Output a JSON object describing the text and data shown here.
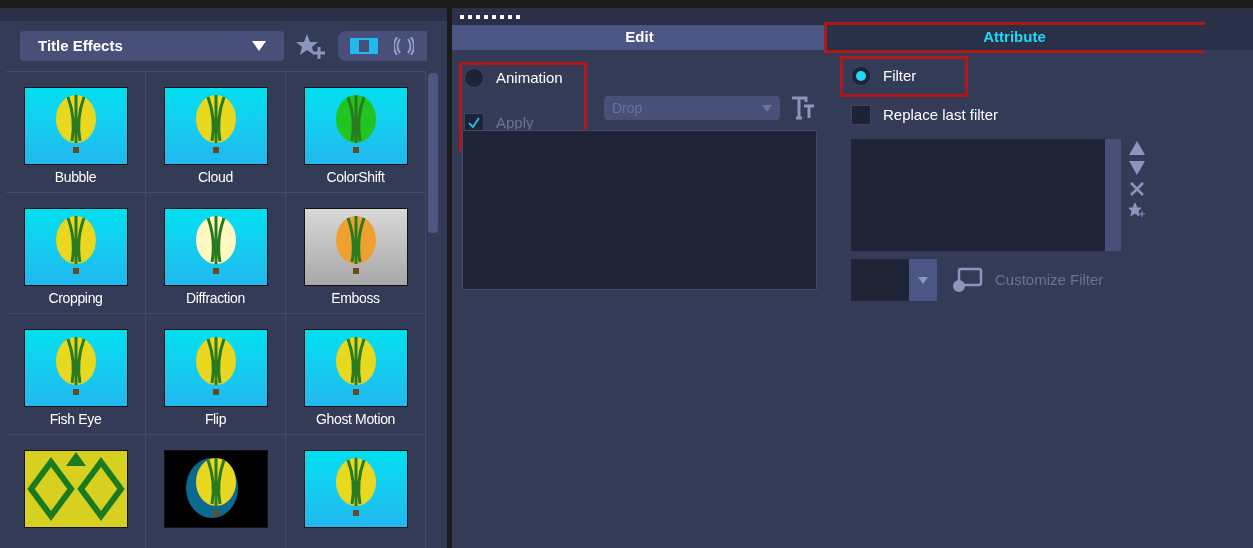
{
  "library": {
    "category": "Title Effects",
    "effects": [
      {
        "name": "Bubble",
        "kind": "sky"
      },
      {
        "name": "Cloud",
        "kind": "sky"
      },
      {
        "name": "ColorShift",
        "kind": "green"
      },
      {
        "name": "Cropping",
        "kind": "sky"
      },
      {
        "name": "Diffraction",
        "kind": "glow"
      },
      {
        "name": "Emboss",
        "kind": "gray"
      },
      {
        "name": "Fish Eye",
        "kind": "sky"
      },
      {
        "name": "Flip",
        "kind": "sky"
      },
      {
        "name": "Ghost Motion",
        "kind": "sky"
      },
      {
        "kind": "pattern"
      },
      {
        "kind": "dark"
      },
      {
        "kind": "sky"
      }
    ]
  },
  "tabs": [
    {
      "label": "Edit",
      "selected": true,
      "highlighted": false
    },
    {
      "label": "Attribute",
      "selected": false,
      "highlighted": true
    }
  ],
  "animation": {
    "label": "Animation",
    "selected": false,
    "highlighted": true,
    "apply": {
      "label": "Apply",
      "checked": true,
      "disabled": true
    },
    "preset": "Drop"
  },
  "filter": {
    "label": "Filter",
    "selected": true,
    "highlighted": true,
    "replace_last": {
      "label": "Replace last filter",
      "checked": false
    },
    "customize": "Customize Filter"
  }
}
